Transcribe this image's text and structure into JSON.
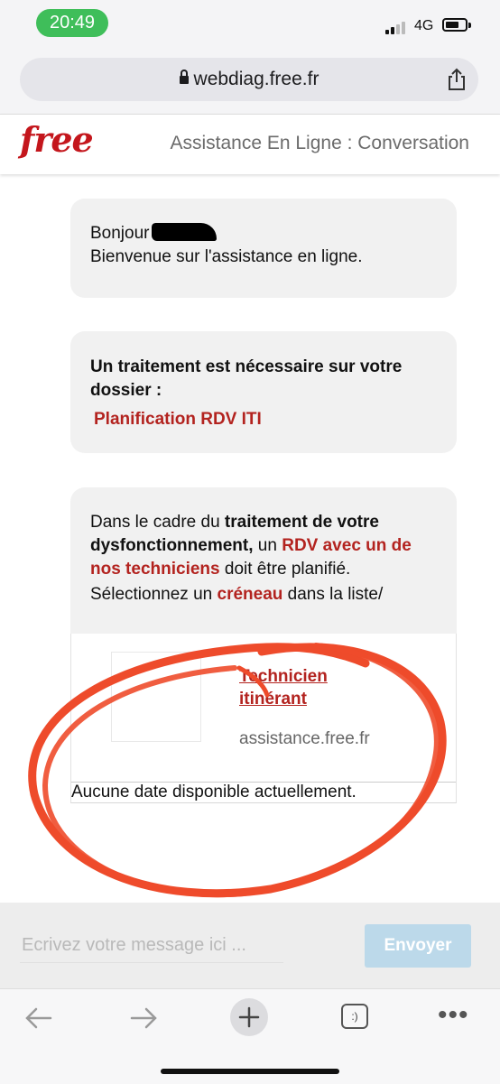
{
  "status_bar": {
    "time": "20:49",
    "network": "4G",
    "colors": {
      "time_pill": "#3fbe5a"
    }
  },
  "browser": {
    "url": "webdiag.free.fr"
  },
  "header": {
    "logo": "free",
    "title": "Assistance En Ligne : Conversation",
    "brand_color": "#c4161c"
  },
  "messages": {
    "greeting": {
      "hello": "Bonjour",
      "welcome": "Bienvenue sur l'assistance en ligne."
    },
    "treatment": {
      "line": "Un traitement est nécessaire sur votre dossier :",
      "item": "Planification RDV ITI"
    },
    "appointment": {
      "p1": "Dans le cadre du ",
      "p2": "traitement de votre dysfonctionnement,",
      "p3": " un ",
      "p4": "RDV avec un de nos techniciens",
      "p5": " doit être planifié.",
      "p6": "Sélectionnez un ",
      "p7": "créneau",
      "p8": " dans la liste/"
    },
    "card": {
      "link": "Technicien itinérant",
      "domain": "assistance.free.fr",
      "no_date": "Aucune date disponible actuellement."
    }
  },
  "composer": {
    "placeholder": "Ecrivez votre message ici ...",
    "send_label": "Envoyer"
  },
  "toolbar": {
    "tabs_label": ":)"
  },
  "annotation": {
    "color": "#ee4b2b"
  }
}
